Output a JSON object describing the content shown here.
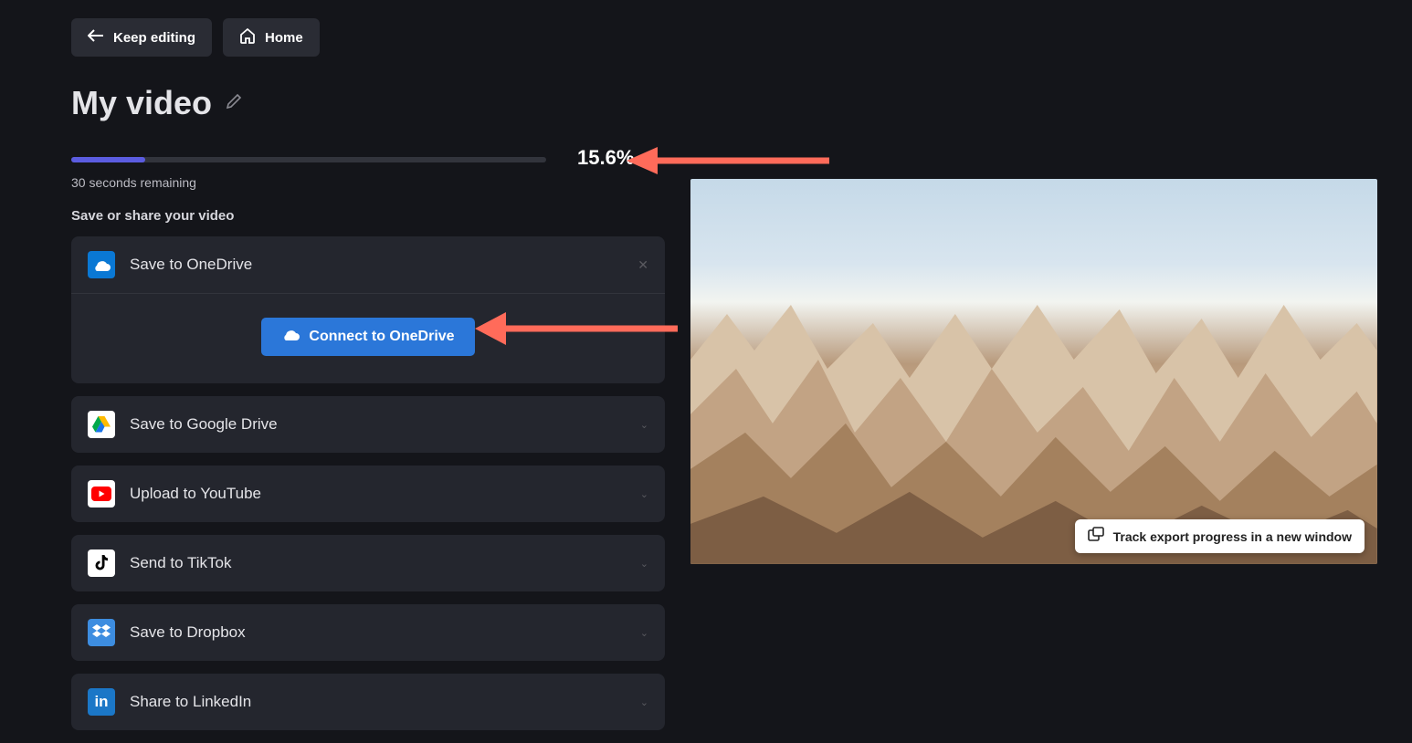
{
  "header": {
    "keep_editing": "Keep editing",
    "home": "Home"
  },
  "title": "My video",
  "progress": {
    "percent": "15.6%",
    "percent_value": 15.6,
    "remaining": "30 seconds remaining"
  },
  "section_label": "Save or share your video",
  "onedrive": {
    "label": "Save to OneDrive",
    "connect": "Connect to OneDrive"
  },
  "options": [
    {
      "label": "Save to Google Drive",
      "icon": "gdrive"
    },
    {
      "label": "Upload to YouTube",
      "icon": "youtube"
    },
    {
      "label": "Send to TikTok",
      "icon": "tiktok"
    },
    {
      "label": "Save to Dropbox",
      "icon": "dropbox"
    },
    {
      "label": "Share to LinkedIn",
      "icon": "linkedin"
    }
  ],
  "track_export": "Track export progress in a new window"
}
